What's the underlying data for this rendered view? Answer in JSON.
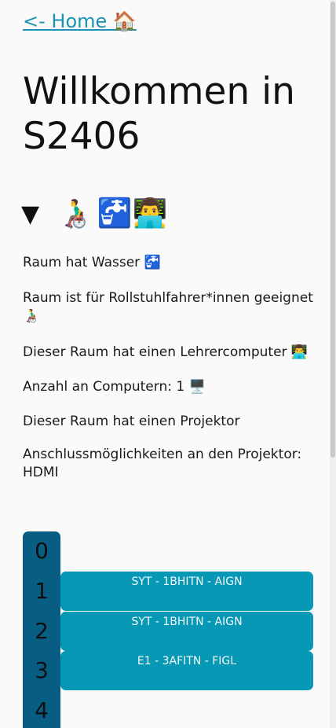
{
  "nav": {
    "home_link": "<- Home 🏠"
  },
  "page": {
    "title": "Willkommen in S2406"
  },
  "summary": {
    "triangle": "▼",
    "wheelchair_emoji": "👨‍🦽",
    "water_emoji": "🚰",
    "teacher_emoji": "👨‍💻"
  },
  "info": {
    "water": "Raum hat Wasser 🚰",
    "wheelchair": "Raum ist für Rollstuhlfahrer*innen geeignet 👨‍🦽",
    "teacher_computer": "Dieser Raum hat einen Lehrercomputer 👨‍💻",
    "computer_count": "Anzahl an Computern: 1 🖥️",
    "projector": "Dieser Raum hat einen Projektor",
    "projector_ports": "Anschlussmöglichkeiten an den Projektor: HDMI"
  },
  "timetable": {
    "periods": [
      "0",
      "1",
      "2",
      "3",
      "4"
    ],
    "lessons": [
      {
        "period": 1,
        "label": "SYT - 1BHITN - AIGN"
      },
      {
        "period": 2,
        "label": "SYT - 1BHITN - AIGN"
      },
      {
        "period": 3,
        "label": "E1 - 3AFITN - FIGL"
      }
    ]
  },
  "colors": {
    "link": "#1a93b0",
    "period_column": "#085e82",
    "lesson_block": "#0798b5"
  }
}
